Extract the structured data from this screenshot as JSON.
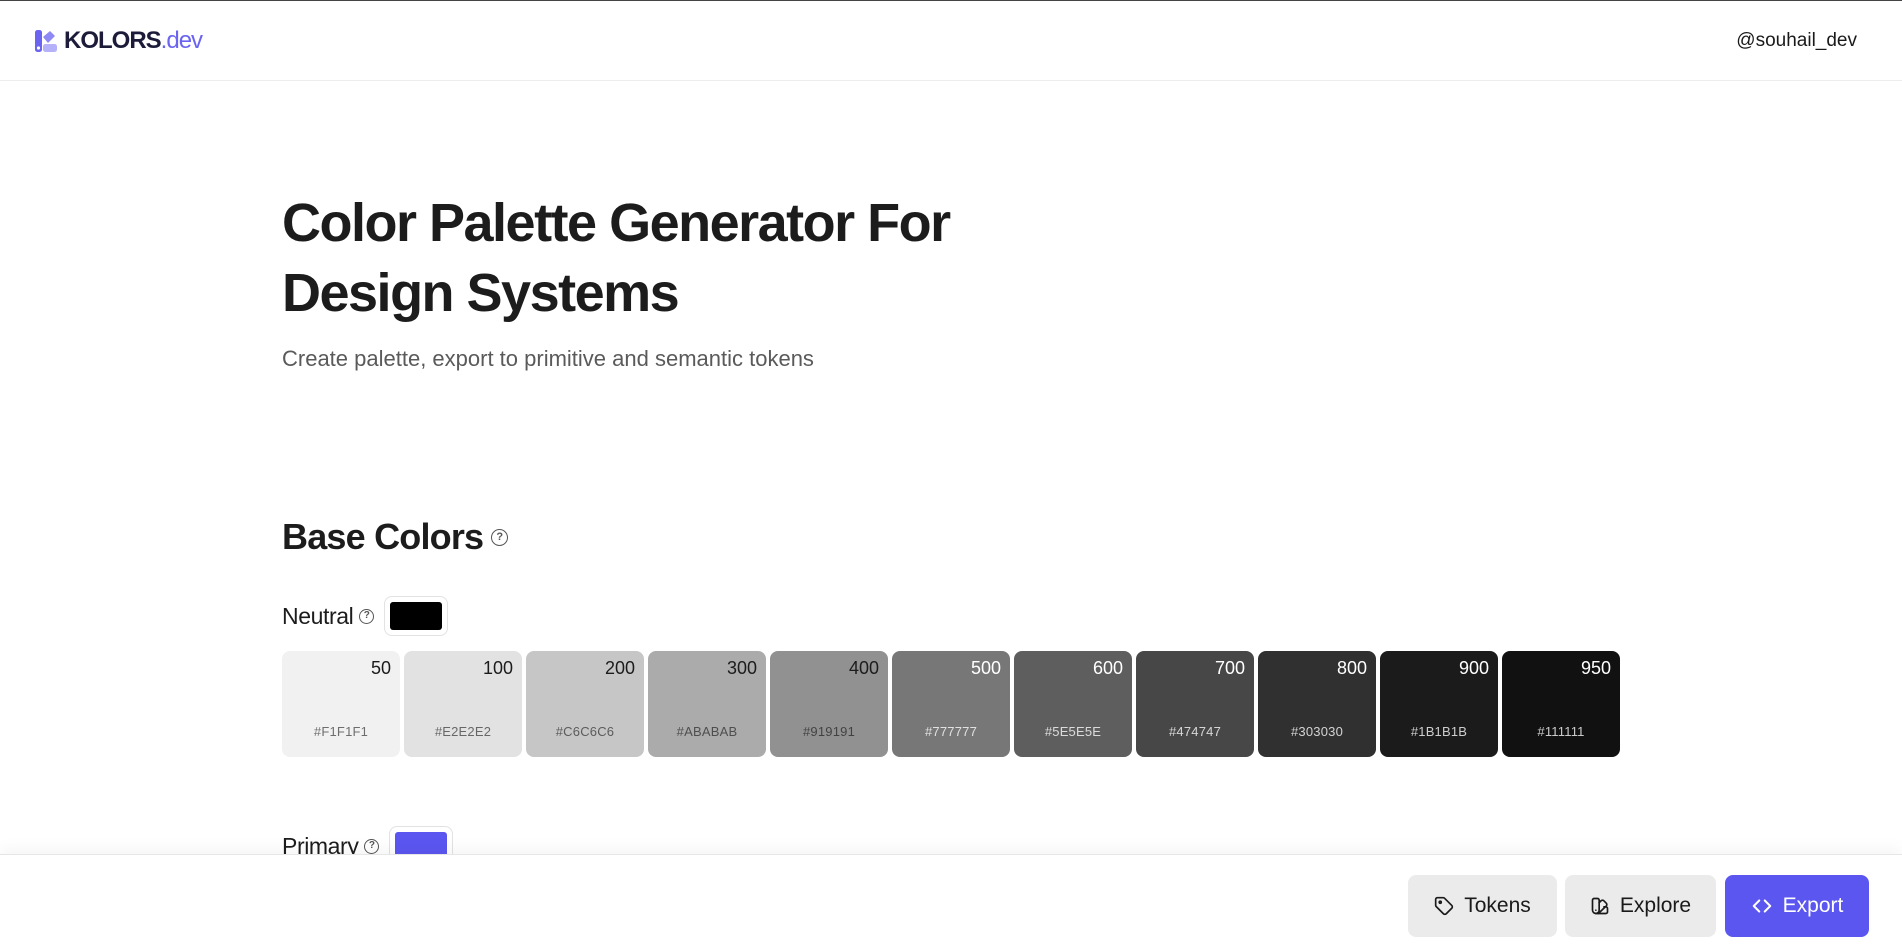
{
  "header": {
    "logo_bold": "KOLORS",
    "logo_light": ".dev",
    "user_handle": "@souhail_dev"
  },
  "hero": {
    "title_line1": "Color Palette Generator For",
    "title_line2": "Design Systems",
    "subtitle": "Create palette, export to primitive and semantic tokens"
  },
  "base_colors": {
    "title": "Base Colors",
    "help_icon": "help-circle-icon",
    "neutral": {
      "label": "Neutral",
      "base_color": "#000000",
      "shades": [
        {
          "step": "50",
          "hex": "#F1F1F1"
        },
        {
          "step": "100",
          "hex": "#E2E2E2"
        },
        {
          "step": "200",
          "hex": "#C6C6C6"
        },
        {
          "step": "300",
          "hex": "#ABABAB"
        },
        {
          "step": "400",
          "hex": "#919191"
        },
        {
          "step": "500",
          "hex": "#777777"
        },
        {
          "step": "600",
          "hex": "#5E5E5E"
        },
        {
          "step": "700",
          "hex": "#474747"
        },
        {
          "step": "800",
          "hex": "#303030"
        },
        {
          "step": "900",
          "hex": "#1B1B1B"
        },
        {
          "step": "950",
          "hex": "#111111"
        }
      ]
    },
    "primary": {
      "label": "Primary",
      "base_color": "#5B56F0"
    }
  },
  "actions": {
    "tokens_label": "Tokens",
    "tokens_icon": "tag-icon",
    "explore_label": "Explore",
    "explore_icon": "swatch-book-icon",
    "export_label": "Export",
    "export_icon": "code-icon"
  },
  "colors": {
    "accent": "#5B56F0",
    "logo_dark": "#1C1C3A"
  }
}
